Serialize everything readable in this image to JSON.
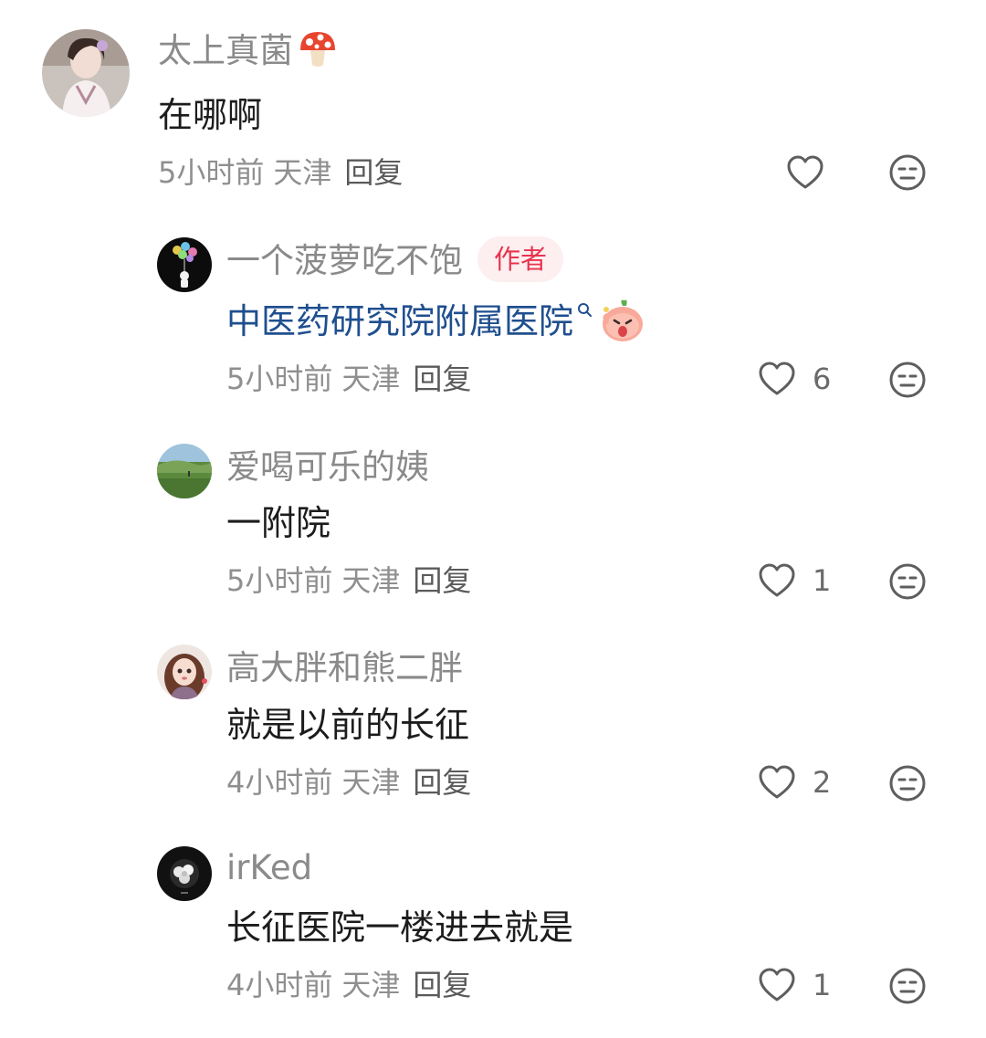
{
  "comments": [
    {
      "username": "太上真菌",
      "username_emoji": "mushroom",
      "text": "在哪啊",
      "time": "5小时前",
      "location": "天津",
      "reply_label": "回复",
      "like_count": "",
      "avatar_icon": "woman-avatar-icon"
    },
    {
      "username": "一个菠萝吃不饱",
      "badge": "作者",
      "text": "中医药研究院附属医院",
      "text_is_link": true,
      "text_sticker": "peach-sticker",
      "time": "5小时前",
      "location": "天津",
      "reply_label": "回复",
      "like_count": "6",
      "avatar_icon": "astronaut-balloon-avatar-icon"
    },
    {
      "username": "爱喝可乐的姨",
      "text": "一附院",
      "time": "5小时前",
      "location": "天津",
      "reply_label": "回复",
      "like_count": "1",
      "avatar_icon": "landscape-avatar-icon"
    },
    {
      "username": "高大胖和熊二胖",
      "text": "就是以前的长征",
      "time": "4小时前",
      "location": "天津",
      "reply_label": "回复",
      "like_count": "2",
      "avatar_icon": "doll-avatar-icon"
    },
    {
      "username": "irKed",
      "text": "长征医院一楼进去就是",
      "time": "4小时前",
      "location": "天津",
      "reply_label": "回复",
      "like_count": "1",
      "avatar_icon": "flower-dark-avatar-icon"
    }
  ],
  "colors": {
    "username": "#8a8a8a",
    "text": "#1c1c1c",
    "link": "#1f4f8f",
    "meta": "#8f8f8f",
    "badge_bg": "#fdeef0",
    "badge_text": "#e8344e"
  }
}
